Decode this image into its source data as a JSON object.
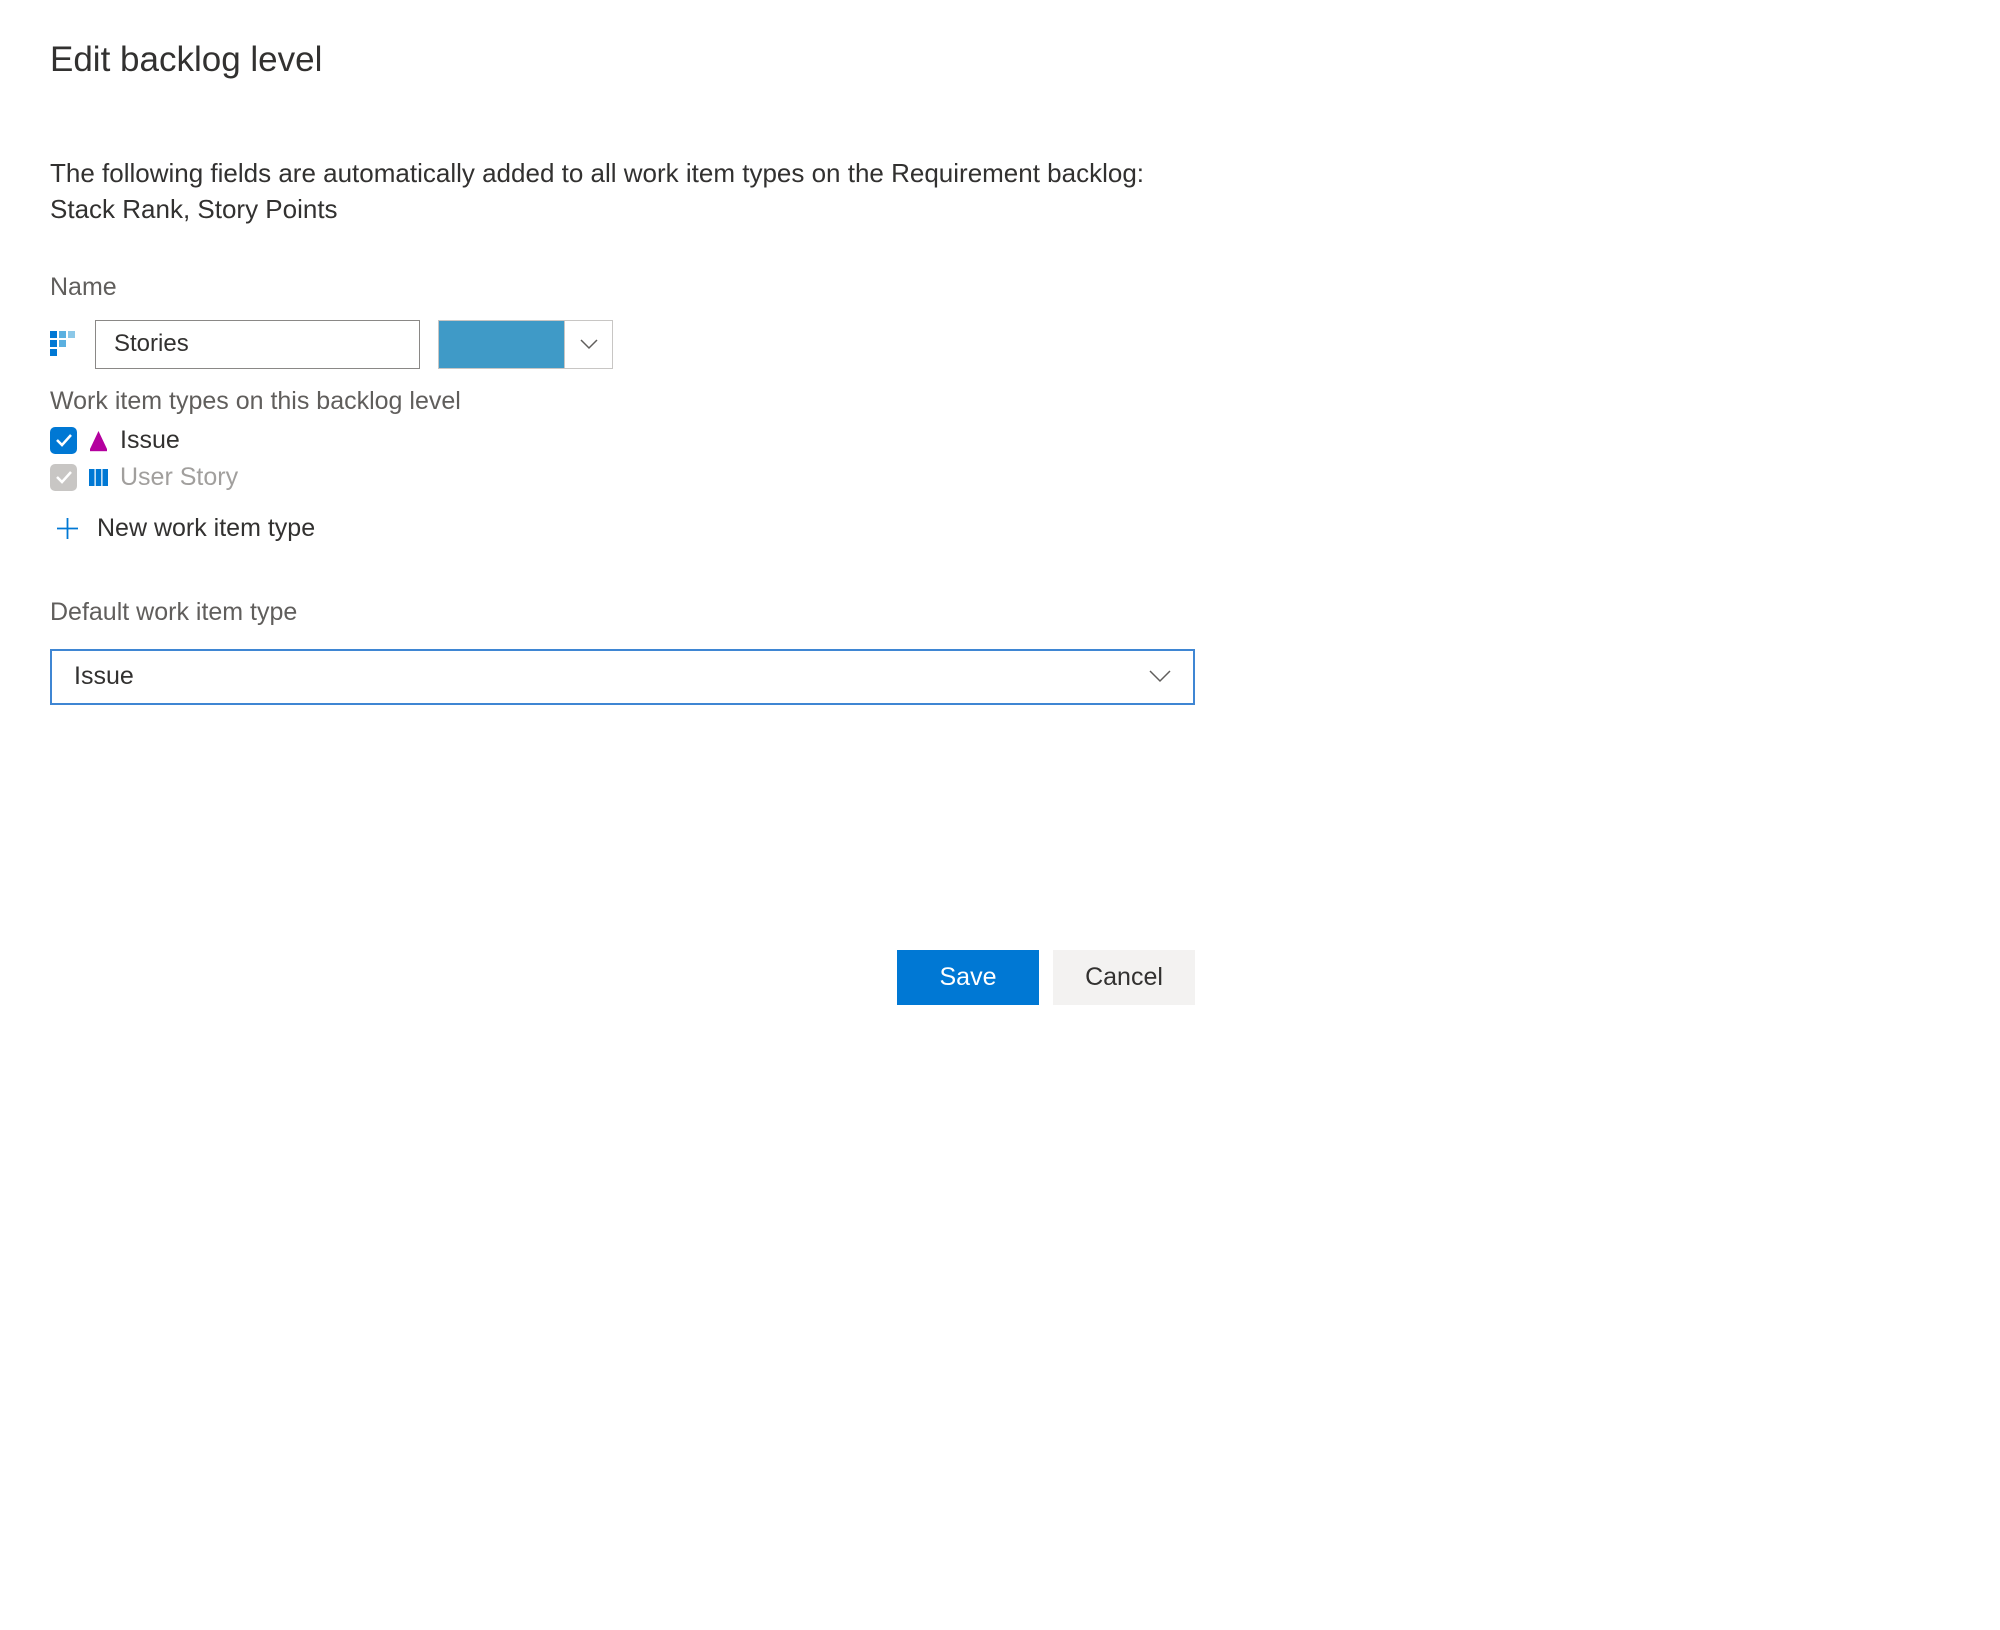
{
  "dialog": {
    "title": "Edit backlog level",
    "description": "The following fields are automatically added to all work item types on the Requirement backlog: Stack Rank, Story Points"
  },
  "name_field": {
    "label": "Name",
    "value": "Stories"
  },
  "color_picker": {
    "color": "#3f9ac7"
  },
  "work_item_types": {
    "section_label": "Work item types on this backlog level",
    "items": [
      {
        "label": "Issue",
        "checked": true,
        "enabled": true,
        "icon": "issue-icon",
        "icon_color": "#b4009e"
      },
      {
        "label": "User Story",
        "checked": true,
        "enabled": false,
        "icon": "user-story-icon",
        "icon_color": "#0078d4"
      }
    ],
    "new_label": "New work item type"
  },
  "default_type": {
    "label": "Default work item type",
    "value": "Issue"
  },
  "buttons": {
    "save": "Save",
    "cancel": "Cancel"
  }
}
